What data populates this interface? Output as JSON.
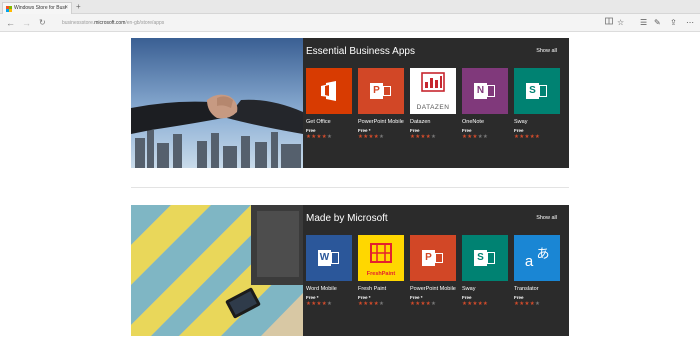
{
  "browser": {
    "tab_title": "Windows Store for Busi",
    "tab_close": "×",
    "new_tab": "+",
    "url_prefix": "businessstore.",
    "url_domain": "microsoft.com",
    "url_path": "/en-gb/store/apps"
  },
  "sections": [
    {
      "title": "Essential Business Apps",
      "show_all": "Show all",
      "apps": [
        {
          "name": "Get Office",
          "price": "Free",
          "rating": 4
        },
        {
          "name": "PowerPoint Mobile",
          "price": "Free",
          "price_mark": "*",
          "rating": 4
        },
        {
          "name": "Datazen",
          "price": "Free",
          "rating": 4,
          "tile_text": "DATAZEN"
        },
        {
          "name": "OneNote",
          "price": "Free",
          "rating": 3
        },
        {
          "name": "Sway",
          "price": "Free",
          "rating": 5
        }
      ]
    },
    {
      "title": "Made by Microsoft",
      "show_all": "Show all",
      "apps": [
        {
          "name": "Word Mobile",
          "price": "Free",
          "price_mark": "*",
          "rating": 4
        },
        {
          "name": "Fresh Paint",
          "price": "Free",
          "price_mark": "*",
          "rating": 4,
          "tile_text": "FreshPaint"
        },
        {
          "name": "PowerPoint Mobile",
          "price": "Free",
          "price_mark": "*",
          "rating": 4
        },
        {
          "name": "Sway",
          "price": "Free",
          "rating": 5
        },
        {
          "name": "Translator",
          "price": "Free",
          "rating": 4,
          "tile_text_1": "a",
          "tile_text_2": "あ"
        }
      ]
    }
  ],
  "colors": {
    "office_orange": "#d83b01",
    "powerpoint_red": "#d24726",
    "onenote_purple": "#80397b",
    "sway_teal": "#008272",
    "word_blue": "#2b579a",
    "freshpaint_yellow": "#ffd700",
    "translator_blue": "#1a86d4",
    "panel_bg": "#2b2b2b",
    "star_on": "#d14b2b"
  }
}
